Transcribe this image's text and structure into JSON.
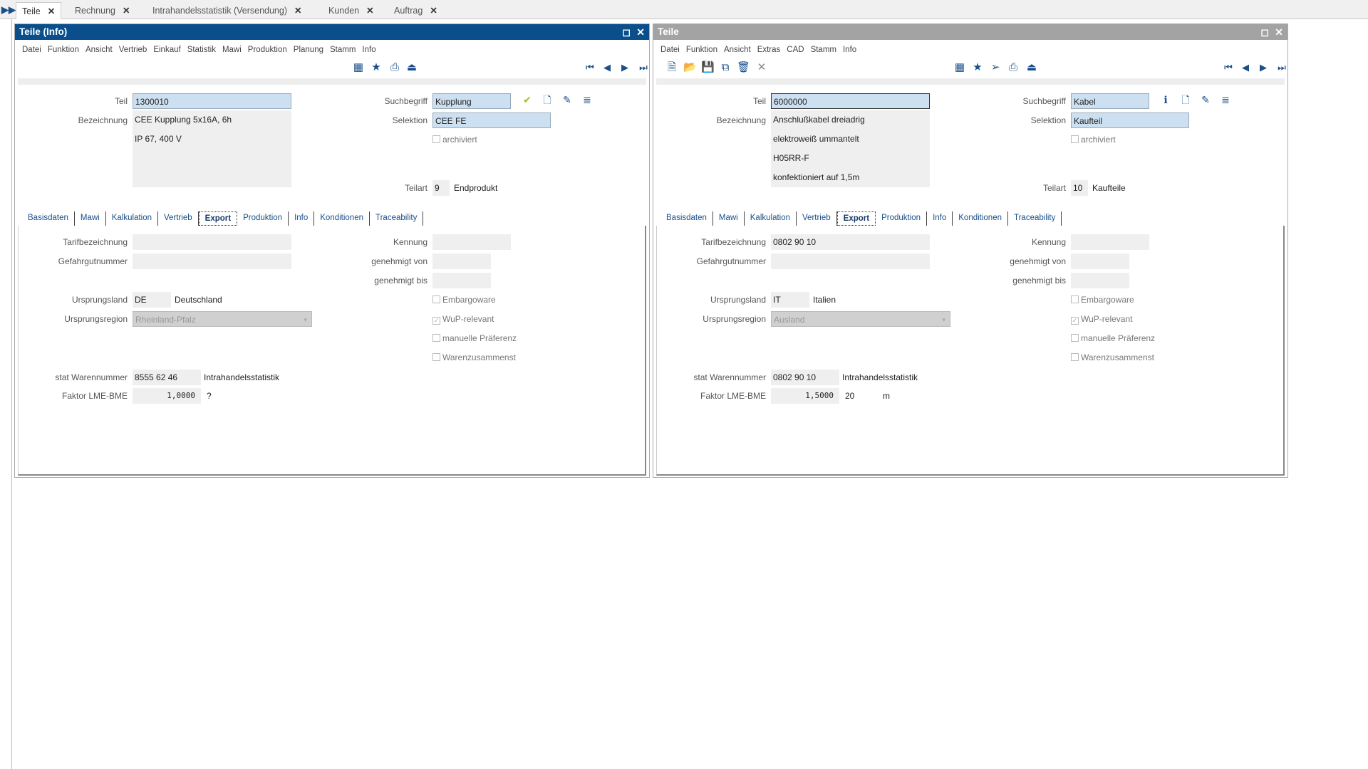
{
  "tabs": [
    {
      "label": "Teile",
      "active": true
    },
    {
      "label": "Rechnung"
    },
    {
      "label": "Intrahandelsstatistik (Versendung)"
    },
    {
      "label": "Kunden"
    },
    {
      "label": "Auftrag"
    }
  ],
  "colors": {
    "active_title": "#0a4f8c",
    "inactive_title": "#a3a3a3",
    "icon_blue": "#1a4f8a"
  },
  "windows": [
    {
      "title": "Teile (Info)",
      "active": true,
      "menu": [
        "Datei",
        "Funktion",
        "Ansicht",
        "Vertrieb",
        "Einkauf",
        "Statistik",
        "Mawi",
        "Produktion",
        "Planung",
        "Stamm",
        "Info"
      ],
      "toolbar_left": [],
      "toolbar_mid": [
        "calendar-icon",
        "star-icon",
        "print-icon",
        "export-icon"
      ],
      "search_icons": [
        "check-icon",
        "new-doc-icon",
        "edit-icon",
        "report-icon"
      ],
      "teil": {
        "label": "Teil",
        "value": "1300010"
      },
      "bezeichnung": {
        "label": "Bezeichnung",
        "lines": [
          "CEE Kupplung 5x16A, 6h",
          "IP 67, 400 V",
          "",
          ""
        ]
      },
      "suchbegriff": {
        "label": "Suchbegriff",
        "value": "Kupplung"
      },
      "selektion": {
        "label": "Selektion",
        "value": "CEE FE"
      },
      "archiviert": {
        "label": "archiviert",
        "checked": false
      },
      "teilart": {
        "label": "Teilart",
        "code": "9",
        "name": "Endprodukt"
      },
      "tabs": [
        "Basisdaten",
        "Mawi",
        "Kalkulation",
        "Vertrieb",
        "Export",
        "Produktion",
        "Info",
        "Konditionen",
        "Traceability"
      ],
      "active_tab": "Export",
      "export": {
        "tarif": {
          "label": "Tarifbezeichnung",
          "value": ""
        },
        "gefahr": {
          "label": "Gefahrgutnummer",
          "value": ""
        },
        "kennung": {
          "label": "Kennung",
          "value": ""
        },
        "gen_von": {
          "label": "genehmigt von",
          "value": ""
        },
        "gen_bis": {
          "label": "genehmigt bis",
          "value": ""
        },
        "land": {
          "label": "Ursprungsland",
          "code": "DE",
          "name": "Deutschland"
        },
        "region": {
          "label": "Ursprungsregion",
          "value": "Rheinland-Pfalz"
        },
        "checks": [
          {
            "label": "Embargoware",
            "checked": false
          },
          {
            "label": "WuP-relevant",
            "checked": true
          },
          {
            "label": "manuelle Präferenz",
            "checked": false
          },
          {
            "label": "Warenzusammenst",
            "checked": false
          }
        ],
        "stat": {
          "label": "stat Warennummer",
          "value": "8555 62 46",
          "name": "Intrahandelsstatistik"
        },
        "faktor": {
          "label": "Faktor LME-BME",
          "value": "1,0000",
          "extra": "?",
          "unit": ""
        }
      }
    },
    {
      "title": "Teile",
      "active": false,
      "menu": [
        "Datei",
        "Funktion",
        "Ansicht",
        "Extras",
        "CAD",
        "Stamm",
        "Info"
      ],
      "toolbar_left": [
        "new-icon",
        "open-icon",
        "save-icon",
        "copy-icon",
        "delete-icon",
        "cancel-icon"
      ],
      "toolbar_mid": [
        "calendar-icon",
        "star-icon",
        "forward-icon",
        "print-icon",
        "export-icon"
      ],
      "search_icons": [
        "info-icon",
        "new-doc-icon",
        "edit-icon",
        "report-icon"
      ],
      "teil": {
        "label": "Teil",
        "value": "6000000"
      },
      "bezeichnung": {
        "label": "Bezeichnung",
        "lines": [
          "Anschlußkabel dreiadrig",
          "elektroweiß ummantelt",
          "H05RR-F",
          "konfektioniert auf 1,5m"
        ]
      },
      "suchbegriff": {
        "label": "Suchbegriff",
        "value": "Kabel"
      },
      "selektion": {
        "label": "Selektion",
        "value": "Kaufteil"
      },
      "archiviert": {
        "label": "archiviert",
        "checked": false
      },
      "teilart": {
        "label": "Teilart",
        "code": "10",
        "name": "Kaufteile"
      },
      "tabs": [
        "Basisdaten",
        "Mawi",
        "Kalkulation",
        "Vertrieb",
        "Export",
        "Produktion",
        "Info",
        "Konditionen",
        "Traceability"
      ],
      "active_tab": "Export",
      "export": {
        "tarif": {
          "label": "Tarifbezeichnung",
          "value": "0802 90 10"
        },
        "gefahr": {
          "label": "Gefahrgutnummer",
          "value": ""
        },
        "kennung": {
          "label": "Kennung",
          "value": ""
        },
        "gen_von": {
          "label": "genehmigt von",
          "value": ""
        },
        "gen_bis": {
          "label": "genehmigt bis",
          "value": ""
        },
        "land": {
          "label": "Ursprungsland",
          "code": "IT",
          "name": "Italien"
        },
        "region": {
          "label": "Ursprungsregion",
          "value": "Ausland"
        },
        "checks": [
          {
            "label": "Embargoware",
            "checked": false
          },
          {
            "label": "WuP-relevant",
            "checked": true
          },
          {
            "label": "manuelle Präferenz",
            "checked": false
          },
          {
            "label": "Warenzusammenst",
            "checked": false
          }
        ],
        "stat": {
          "label": "stat Warennummer",
          "value": "0802 90 10",
          "name": "Intrahandelsstatistik"
        },
        "faktor": {
          "label": "Faktor LME-BME",
          "value": "1,5000",
          "extra": "20",
          "unit": "m"
        }
      }
    }
  ]
}
